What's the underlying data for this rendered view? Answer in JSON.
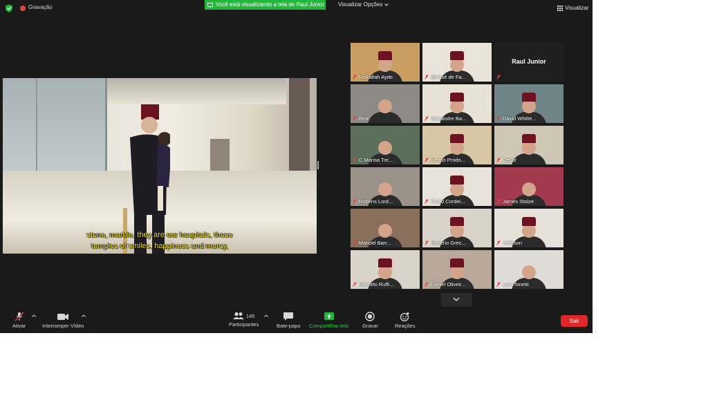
{
  "topbar": {
    "recording_label": "Gravação",
    "share_banner": "Você está visualizando a tela de Raul Junior",
    "view_options": "Visualizar Opções",
    "view_button": "Visualizar"
  },
  "shared_screen": {
    "subtitle_line1": "stone, marble, they are our hospitals, those",
    "subtitle_line2": "temples of smiles,  happiness and mercy,"
  },
  "gallery": {
    "tiles": [
      {
        "name": "Rizkallah Ayde",
        "bg": "#c99f61",
        "fez": true
      },
      {
        "name": "@José de Fa...",
        "bg": "#e9e3d9",
        "fez": true
      },
      {
        "name": "Raul Junior",
        "noimg": true
      },
      {
        "name": "Bea",
        "bg": "#8e8a86",
        "fez": false
      },
      {
        "name": "Alexandre Ba...",
        "bg": "#e8e2d6",
        "fez": true
      },
      {
        "name": "David Whitte...",
        "bg": "#6e8486",
        "fez": true
      },
      {
        "name": "C Marisa Tre...",
        "bg": "#5c6f5a",
        "fez": false
      },
      {
        "name": "Sergio Prodo...",
        "bg": "#d7c7a4",
        "fez": true
      },
      {
        "name": "Cesar",
        "bg": "#cfc7b6",
        "fez": true
      },
      {
        "name": "Rubens Lord...",
        "bg": "#9b938a",
        "fez": false
      },
      {
        "name": "Paulo Cordei...",
        "bg": "#e7e2da",
        "fez": true
      },
      {
        "name": "James Stolze",
        "bg": "#a23a4f",
        "fez": false
      },
      {
        "name": "Manoel Barr...",
        "bg": "#8a6f5c",
        "fez": false
      },
      {
        "name": "Rogerio Grec...",
        "bg": "#d9d3c9",
        "fez": true
      },
      {
        "name": "Jelfeson",
        "bg": "#e6e1d8",
        "fez": true
      },
      {
        "name": "Marcelo Ruffi...",
        "bg": "#d9d3c9",
        "fez": true
      },
      {
        "name": "Daniel Oliveir...",
        "bg": "#b8a899",
        "fez": true
      },
      {
        "name": "Luis Tonetti",
        "bg": "#dfdcd7",
        "fez": false
      }
    ]
  },
  "toolbar": {
    "mute_label": "Ativar",
    "video_label": "Interromper Vídeo",
    "participants_label": "Participantes",
    "participants_count": "145",
    "chat_label": "Bate-papo",
    "share_label": "Compartilhar tela",
    "record_label": "Gravar",
    "reactions_label": "Reações",
    "leave_label": "Sair"
  },
  "colors": {
    "background": "#1a1a1a",
    "share_green": "#23b73c",
    "leave_red": "#e02828",
    "fez_red": "#6b1320"
  },
  "icons": [
    "shield-icon",
    "record-dot-icon",
    "view-grid-icon",
    "microphone-muted-icon",
    "video-camera-icon",
    "participants-icon",
    "chat-icon",
    "share-screen-icon",
    "record-icon",
    "reactions-icon",
    "chevron-down-icon"
  ]
}
